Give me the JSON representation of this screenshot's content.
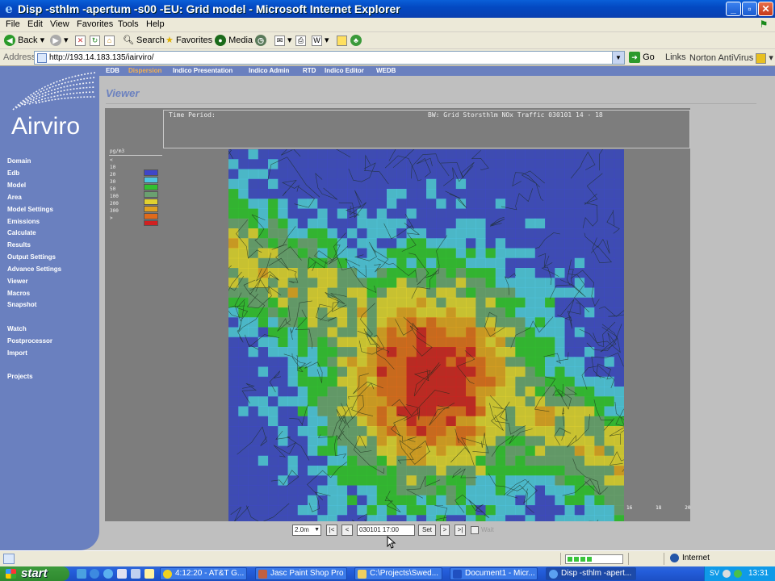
{
  "window": {
    "title": "Disp -sthlm -apertum -s00 -EU: Grid model - Microsoft Internet Explorer",
    "buttons": [
      "_",
      "▫",
      "✕"
    ]
  },
  "menu": [
    "File",
    "Edit",
    "View",
    "Favorites",
    "Tools",
    "Help"
  ],
  "toolbar": {
    "back": "Back",
    "search": "Search",
    "favorites": "Favorites",
    "media": "Media"
  },
  "address": {
    "label": "Address",
    "url": "http://193.14.183.135/iairviro/",
    "go": "Go",
    "links": "Links",
    "norton": "Norton AntiVirus"
  },
  "logo": "Airviro",
  "sidebar": [
    "Domain",
    "Edb",
    "Model",
    "Area",
    "Model Settings",
    "Emissions",
    "Calculate",
    "Results",
    "Output Settings",
    "Advance Settings",
    "Viewer",
    "Macros",
    "Snapshot",
    "Watch",
    "Postprocessor",
    "Import",
    "Projects"
  ],
  "topnav": [
    "EDB",
    "Dispersion",
    "Indico Presentation",
    "Indico Admin",
    "RTD",
    "Indico Editor",
    "WEDB"
  ],
  "topnav_active": "Dispersion",
  "page_title": "Viewer",
  "info": {
    "time_period": "Time Period:",
    "bw": "BW: Grid Storsthlm NOx Traffic 030101 14 - 18"
  },
  "legend": {
    "unit": "pg/m3",
    "rows": [
      {
        "label": "<",
        "color": ""
      },
      {
        "label": "10",
        "color": "#3f46c8"
      },
      {
        "label": "20",
        "color": "#4fc4e0"
      },
      {
        "label": "30",
        "color": "#32c030"
      },
      {
        "label": "50",
        "color": "#6aa070"
      },
      {
        "label": "100",
        "color": "#e0d030"
      },
      {
        "label": "200",
        "color": "#e0a020"
      },
      {
        "label": "300",
        "color": "#e06a1a"
      },
      {
        "label": ">",
        "color": "#d02020"
      }
    ]
  },
  "scale_labels": [
    "16",
    "18",
    "20"
  ],
  "controls": {
    "step": "2.0m",
    "first": "|<",
    "prev": "<",
    "datetime": "030101 17:00",
    "set": "Set",
    "next": ">",
    "last": ">|",
    "wait": "Wait"
  },
  "status": {
    "zone": "Internet",
    "progress_fraction": 0.45
  },
  "taskbar": {
    "start": "start",
    "tasks": [
      "4:12:20 - AT&T G...",
      "Jasc Paint Shop Pro",
      "C:\\Projects\\Swed...",
      "Document1 - Micr...",
      "Disp -sthlm -apert..."
    ],
    "active_task": 4,
    "lang": "SV",
    "clock": "13:31"
  },
  "colors": {
    "sidebar": "#6a80bf",
    "panel": "#7d7d7d",
    "active_nav": "#f4b050"
  }
}
